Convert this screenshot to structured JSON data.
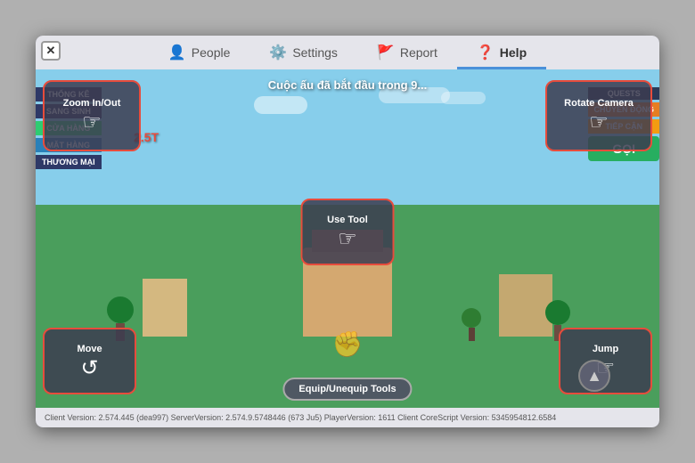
{
  "window": {
    "close_label": "✕"
  },
  "nav": {
    "tabs": [
      {
        "id": "people",
        "label": "People",
        "icon": "👤",
        "active": false
      },
      {
        "id": "settings",
        "label": "Settings",
        "icon": "⚙️",
        "active": false
      },
      {
        "id": "report",
        "label": "Report",
        "icon": "🚩",
        "active": false
      },
      {
        "id": "help",
        "label": "Help",
        "icon": "❓",
        "active": true
      }
    ]
  },
  "game": {
    "notice_text": "Cuộc ấu đã bắt đầu trong 9...",
    "price_badge": "2.5T"
  },
  "left_sidebar": {
    "items": [
      {
        "label": "THỐNG KÊ",
        "style": "default"
      },
      {
        "label": "SANG SINH",
        "style": "default"
      },
      {
        "label": "CỬA HÀNG",
        "style": "green"
      },
      {
        "label": "MẶT HÀNG",
        "style": "default"
      },
      {
        "label": "THƯƠNG MẠI",
        "style": "default"
      }
    ]
  },
  "right_sidebar": {
    "header": "QUESTS",
    "items": [
      {
        "label": "CHUYỂN ĐỘNG",
        "style": "orange"
      },
      {
        "label": "TIẾP CẬN",
        "style": "yellow"
      },
      {
        "label": "GỌI",
        "style": "green-btn"
      }
    ]
  },
  "controls": {
    "zoom": {
      "label": "Zoom In/Out"
    },
    "rotate": {
      "label": "Rotate Camera"
    },
    "use_tool": {
      "label": "Use Tool"
    },
    "equip": {
      "label": "Equip/Unequip Tools"
    },
    "move": {
      "label": "Move"
    },
    "jump": {
      "label": "Jump"
    }
  },
  "status_bar": {
    "text": "Client Version: 2.574.445 (dea997)   ServerVersion: 2.574.9.5748446 (673 Ju5)   PlayerVersion: 1611   Client CoreScript Version: 5345954812.6584"
  }
}
